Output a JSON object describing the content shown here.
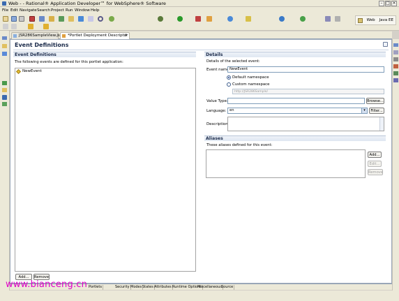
{
  "window": {
    "title": "Web - - Rational® Application Developer™ for WebSphere® Software"
  },
  "menu": [
    "File",
    "Edit",
    "Navigate",
    "Search",
    "Project",
    "Run",
    "Window",
    "Help"
  ],
  "perspectives": {
    "web": "Web",
    "javaee": "Java EE"
  },
  "tabs": [
    {
      "label": "JSR286SampleView.jsp"
    },
    {
      "label": "*Portlet Deployment Descriptor"
    }
  ],
  "form": {
    "title": "Event Definitions"
  },
  "events": {
    "heading": "Event Definitions",
    "description": "The following events are defined for this portlet application:",
    "items": [
      "NewEvent"
    ],
    "add_label": "Add...",
    "remove_label": "Remove"
  },
  "details": {
    "heading": "Details",
    "description": "Details of the selected event:",
    "event_name_label": "Event name:",
    "event_name_value": "NewEvent",
    "default_ns_label": "Default namespace",
    "custom_ns_label": "Custom namespace",
    "custom_ns_placeholder": "http://JSR286Sample/",
    "value_type_label": "Value Type:",
    "value_type_value": "",
    "browse_label": "Browse...",
    "language_label": "Language:",
    "language_value": "en",
    "filter_label": "Filter...",
    "description_label": "Description:"
  },
  "aliases": {
    "heading": "Aliases",
    "description": "These aliases defined for this event:",
    "add_label": "Add...",
    "edit_label": "Edit...",
    "remove_label": "Remove"
  },
  "page_tabs": [
    "Portlets",
    "Security",
    "Modes",
    "States",
    "Attributes",
    "Runtime Options",
    "Miscellaneous",
    "Source"
  ],
  "watermark": "www.bianceng.cn"
}
